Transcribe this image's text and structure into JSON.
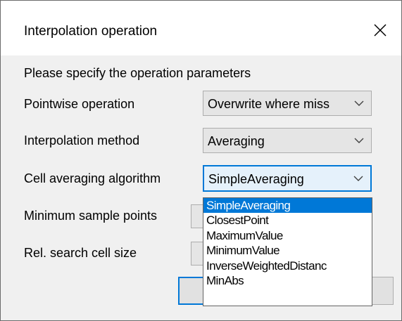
{
  "window": {
    "title": "Interpolation operation"
  },
  "instructions": "Please specify the operation parameters",
  "fields": {
    "pointwise": {
      "label": "Pointwise operation",
      "value": "Overwrite where miss"
    },
    "interpolation": {
      "label": "Interpolation method",
      "value": "Averaging"
    },
    "cell_averaging": {
      "label": "Cell averaging algorithm",
      "value": "SimpleAveraging"
    },
    "min_samples": {
      "label": "Minimum sample points"
    },
    "search_cell": {
      "label": "Rel. search cell size"
    }
  },
  "dropdown": {
    "options": [
      "SimpleAveraging",
      "ClosestPoint",
      "MaximumValue",
      "MinimumValue",
      "InverseWeightedDistanc",
      "MinAbs"
    ],
    "selected": "SimpleAveraging"
  },
  "icons": {
    "close": "close-icon",
    "chevron": "chevron-down-icon"
  },
  "colors": {
    "accent": "#0078d7",
    "dialog_bg": "#f0f0f0",
    "combo_bg": "#e5e5e5"
  }
}
